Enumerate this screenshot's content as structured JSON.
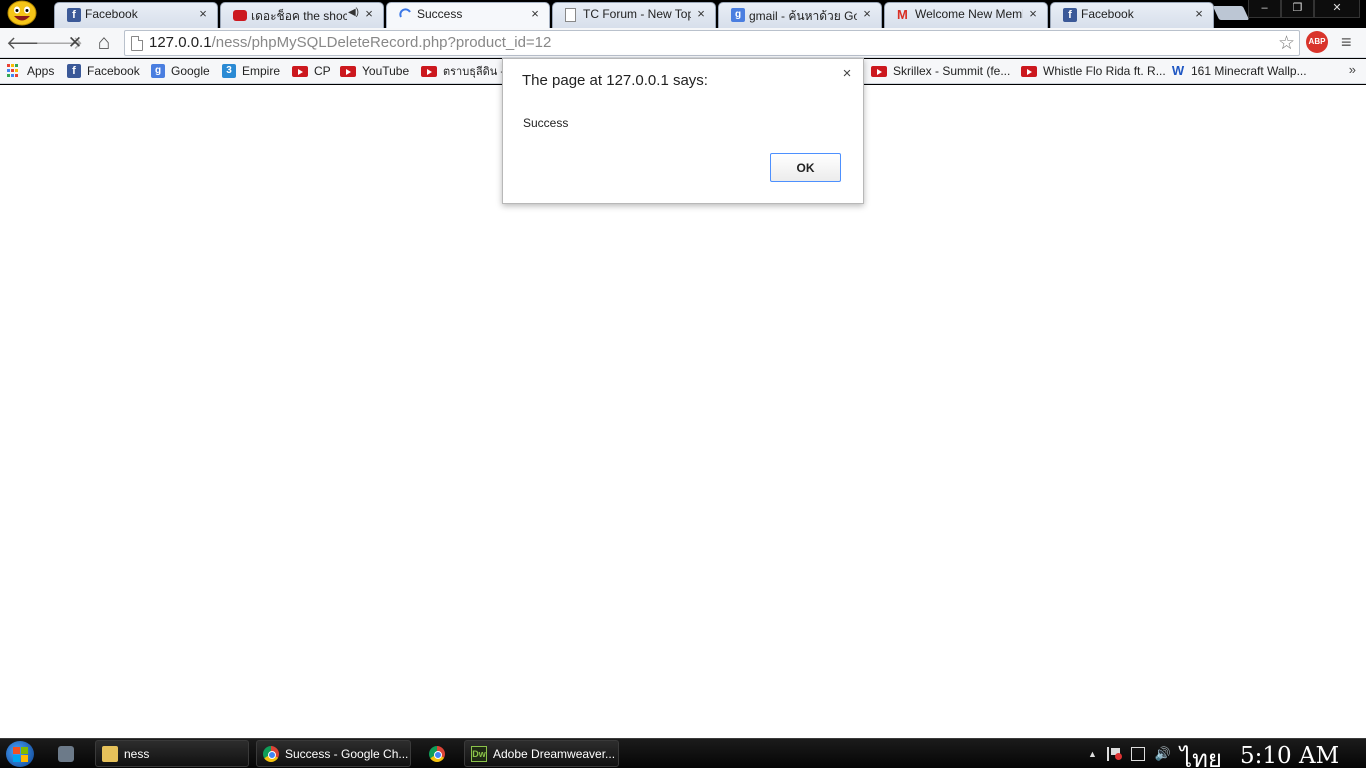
{
  "browser": {
    "tabs": [
      {
        "title": "Facebook",
        "icon": "facebook-icon",
        "active": false
      },
      {
        "title": "เดอะช็อค the shock",
        "icon": "youtube-icon",
        "active": false,
        "audio": true
      },
      {
        "title": "Success",
        "icon": "loading-spinner-icon",
        "active": true
      },
      {
        "title": "TC Forum - New Topic",
        "icon": "page-icon",
        "active": false
      },
      {
        "title": "gmail - ค้นหาด้วย Google",
        "icon": "google-icon",
        "active": false
      },
      {
        "title": "Welcome New Member",
        "icon": "gmail-icon",
        "active": false
      },
      {
        "title": "Facebook",
        "icon": "facebook-icon",
        "active": false
      }
    ],
    "tab_close_glyph": "×",
    "window_buttons": {
      "minimize": "–",
      "restore": "❐",
      "close": "✕"
    }
  },
  "toolbar": {
    "back": "🡐",
    "forward": "🡒",
    "stop": "✕",
    "home": "⌂",
    "url_host": "127.0.0.1",
    "url_path": "/ness/phpMySQLDeleteRecord.php?product_id=12",
    "star": "☆",
    "abp_label": "ABP",
    "menu": "≡"
  },
  "bookmarks": {
    "items": [
      {
        "label": "Apps",
        "icon": "apps-icon"
      },
      {
        "label": "Facebook",
        "icon": "facebook-icon"
      },
      {
        "label": "Google",
        "icon": "google-icon"
      },
      {
        "label": "Empire",
        "icon": "empire-icon"
      },
      {
        "label": "CP",
        "icon": "youtube-icon"
      },
      {
        "label": "YouTube",
        "icon": "youtube-icon"
      },
      {
        "label": "ตราบธุลีดิน -",
        "icon": "youtube-icon"
      },
      {
        "label": "Skrillex - Summit (fe...",
        "icon": "youtube-icon"
      },
      {
        "label": "Whistle Flo Rida ft. R...",
        "icon": "youtube-icon"
      },
      {
        "label": "161 Minecraft Wallp...",
        "icon": "w-icon"
      }
    ],
    "more": "»"
  },
  "dialog": {
    "title": "The page at 127.0.0.1 says:",
    "message": "Success",
    "ok_label": "OK",
    "close_glyph": "×"
  },
  "taskbar": {
    "items": [
      {
        "label": "ness",
        "icon": "folder-icon"
      },
      {
        "label": "Success - Google Ch...",
        "icon": "chrome-icon"
      },
      {
        "label": "",
        "icon": "chrome-icon"
      },
      {
        "label": "Adobe Dreamweaver...",
        "icon": "dreamweaver-icon"
      }
    ],
    "dw_badge": "Dw",
    "tray_up": "▲",
    "volume": "🔊",
    "language": "ไทย",
    "clock": "5:10 AM"
  },
  "colors": {
    "dialog_ok_border": "#4d90fe",
    "taskbar_bg": "#0a0a0a",
    "page_bg": "#ffffff"
  }
}
